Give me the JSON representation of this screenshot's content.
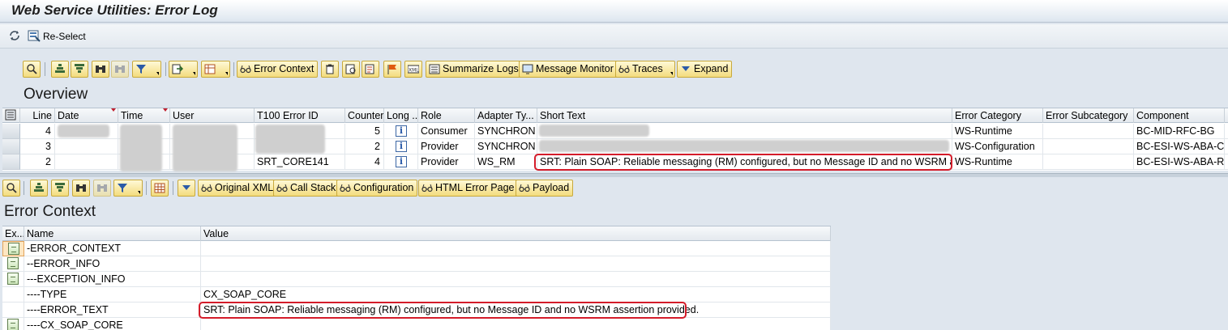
{
  "window": {
    "title": "Web Service Utilities: Error Log"
  },
  "app_toolbar": {
    "reselect_label": "Re-Select"
  },
  "overview": {
    "section_title": "Overview",
    "toolbar": {
      "error_context_label": "Error Context",
      "summarize_logs_label": "Summarize Logs",
      "message_monitor_label": "Message Monitor",
      "traces_label": "Traces",
      "expand_label": "Expand"
    },
    "columns": [
      "Line",
      "Date",
      "Time",
      "User",
      "T100 Error ID",
      "Counter",
      "Long ...",
      "Role",
      "Adapter Ty...",
      "Short Text",
      "Error Category",
      "Error Subcategory",
      "Component"
    ],
    "rows": [
      {
        "line": "4",
        "t100": "",
        "counter": "5",
        "role": "Consumer",
        "adapter": "SYNCHRON",
        "short_text": "",
        "category": "WS-Runtime",
        "subcategory": "",
        "component": "BC-MID-RFC-BG"
      },
      {
        "line": "3",
        "t100": "",
        "counter": "2",
        "role": "Provider",
        "adapter": "SYNCHRON",
        "short_text": "",
        "category": "WS-Configuration",
        "subcategory": "",
        "component": "BC-ESI-WS-ABA-C..."
      },
      {
        "line": "2",
        "t100": "SRT_CORE141",
        "counter": "4",
        "role": "Provider",
        "adapter": "WS_RM",
        "short_text": "SRT: Plain SOAP: Reliable messaging (RM) configured, but no Message ID and no WSRM as...",
        "category": "WS-Runtime",
        "subcategory": "",
        "component": "BC-ESI-WS-ABA-RT"
      }
    ]
  },
  "error_context": {
    "toolbar": {
      "original_xml_label": "Original XML",
      "call_stack_label": "Call Stack",
      "configuration_label": "Configuration",
      "html_error_page_label": "HTML Error Page",
      "payload_label": "Payload"
    },
    "section_title": "Error Context",
    "columns": [
      "Ex...",
      "Name",
      "Value"
    ],
    "rows": [
      {
        "name": "-ERROR_CONTEXT",
        "value": "",
        "icon": "structure-icon"
      },
      {
        "name": "--ERROR_INFO",
        "value": "",
        "icon": "structure-icon"
      },
      {
        "name": "---EXCEPTION_INFO",
        "value": "",
        "icon": "structure-icon"
      },
      {
        "name": "----TYPE",
        "value": "CX_SOAP_CORE",
        "icon": ""
      },
      {
        "name": "----ERROR_TEXT",
        "value": "SRT: Plain SOAP: Reliable messaging (RM) configured, but no Message ID and no WSRM assertion provided.",
        "icon": ""
      },
      {
        "name": "----CX_SOAP_CORE",
        "value": "",
        "icon": "structure-icon"
      }
    ]
  },
  "colors": {
    "button_fill": "#f3dc7e",
    "highlight_border": "#d41c2a",
    "background": "#dfe6ee"
  }
}
